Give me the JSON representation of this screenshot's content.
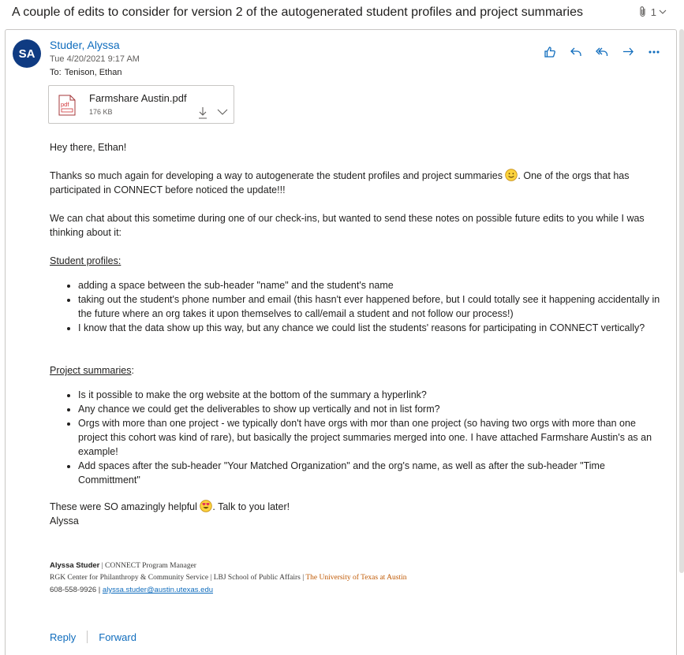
{
  "subject": "A couple of edits to consider for version 2 of the autogenerated student profiles and project summaries",
  "attachment_count": "1",
  "message": {
    "avatar_initials": "SA",
    "sender": "Studer, Alyssa",
    "date": "Tue 4/20/2021 9:17 AM",
    "to_label": "To:",
    "to": "Tenison, Ethan"
  },
  "attachment": {
    "name": "Farmshare Austin.pdf",
    "size": "176 KB",
    "type_label": "pdf"
  },
  "body": {
    "greeting": "Hey there, Ethan!",
    "para1_a": "Thanks so much again for developing a way to autogenerate the student profiles and project summaries ",
    "para1_b": ". One of the orgs that has participated in CONNECT before noticed the update!!!",
    "para2": "We can chat about this sometime during one of our check-ins, but wanted to send these notes on possible future edits to you while I was thinking about it:",
    "section1_title": "Student profiles: ",
    "section1_items": [
      "adding a space between the sub-header \"name\" and the student's name",
      "taking out the student's phone number and email (this hasn't ever happened before, but I could totally see it happening accidentally in the future where an org takes it upon themselves to call/email a student and not follow our process!)",
      "I know that the data show up this way, but any chance we could list the students' reasons for participating in CONNECT vertically?"
    ],
    "section2_title": "Project summaries",
    "section2_colon": ":",
    "section2_items": [
      "Is it possible to make the org website at the bottom of the summary a hyperlink?",
      "Any chance we could get the deliverables to show up vertically and not in list form?",
      "Orgs with more than one project - we typically don't have orgs with mor than one project (so having two orgs with more than one project this cohort was kind of rare), but basically the project summaries merged into one. I have attached Farmshare Austin's as an example!",
      "Add spaces after the sub-header \"Your Matched Organization\" and the org's name, as well as after the sub-header \"Time Committment\""
    ],
    "closing_a": "These were SO amazingly helpful ",
    "closing_b": ". Talk to you later!",
    "sign_name": "Alyssa"
  },
  "signature": {
    "name": "Alyssa Studer",
    "title": " | CONNECT Program Manager",
    "line2": "RGK Center for Philanthropy & Community Service | LBJ School of Public Affairs | ",
    "university": "The University of Texas at Austin",
    "phone": "608-558-9926 | ",
    "email": "alyssa.studer@austin.utexas.edu"
  },
  "footer": {
    "reply": "Reply",
    "forward": "Forward"
  },
  "icons": {
    "like": "thumbs-up-icon",
    "reply": "reply-icon",
    "reply_all": "reply-all-icon",
    "forward": "forward-icon",
    "more": "more-icon",
    "paperclip": "paperclip-icon"
  },
  "colors": {
    "accent": "#0f6cbd",
    "avatar": "#0f3b82",
    "ut_orange": "#bf5700"
  }
}
